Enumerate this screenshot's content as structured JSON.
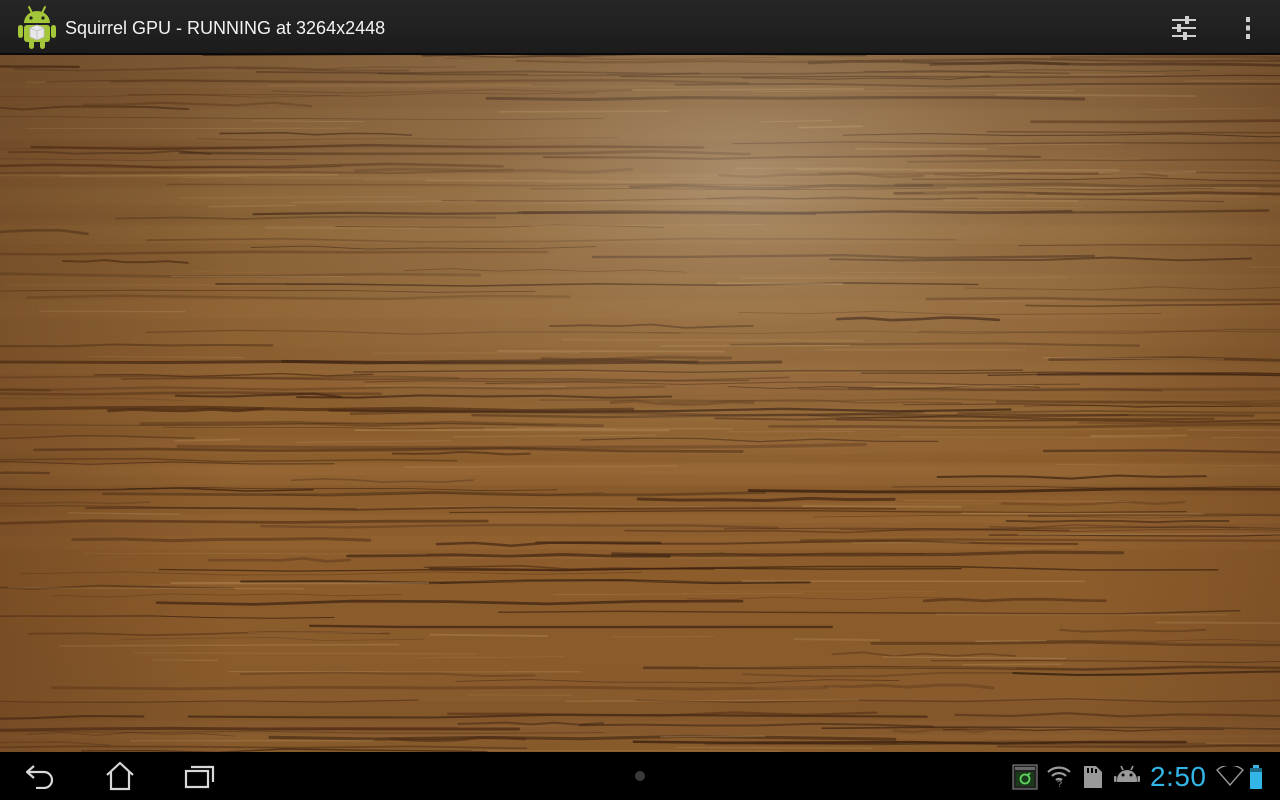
{
  "action_bar": {
    "title": "Squirrel GPU - RUNNING at 3264x2448",
    "app_icon": "android-robot-icon",
    "settings_icon": "sliders-icon",
    "overflow_icon": "overflow-menu-icon"
  },
  "preview": {
    "content": "camera-preview-wood-grain"
  },
  "system_bar": {
    "nav_buttons": [
      "back-icon",
      "home-icon",
      "recent-apps-icon"
    ],
    "notification_icons": [
      "screenshot-icon",
      "wifi-icon",
      "sd-card-icon",
      "android-debug-icon"
    ],
    "clock": "2:50",
    "status_icons": [
      "wifi-signal-icon",
      "battery-icon"
    ],
    "accent_color": "#33b5e5"
  }
}
